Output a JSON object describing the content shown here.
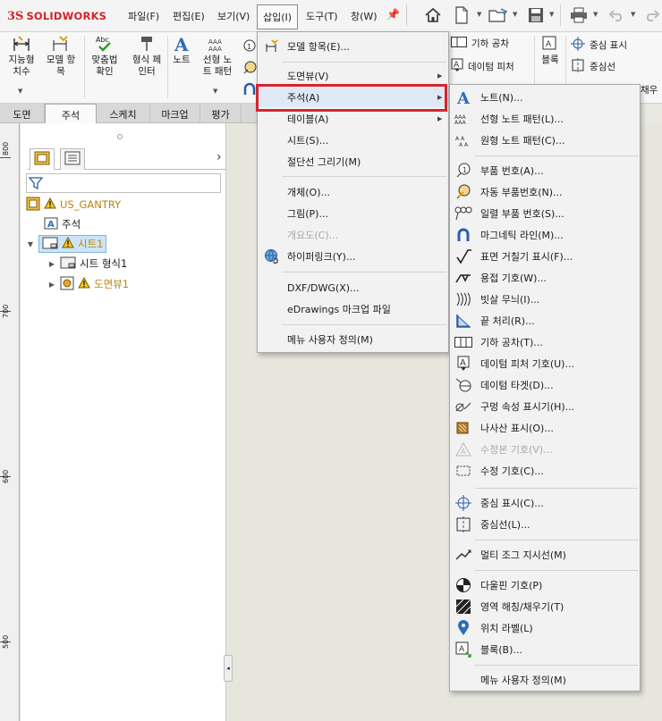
{
  "app": {
    "brand_prefix": "3S",
    "brand_name": "SOLIDWORKS"
  },
  "menubar": {
    "items": [
      "파일(F)",
      "편집(E)",
      "보기(V)",
      "삽입(I)",
      "도구(T)",
      "창(W)"
    ]
  },
  "toolbar": {
    "icons": [
      "home-icon",
      "new-document-icon",
      "open-icon",
      "save-icon",
      "print-icon",
      "undo-icon",
      "redo-icon"
    ]
  },
  "ribbon": {
    "buttons": [
      {
        "label": "지능형\n치수"
      },
      {
        "label": "모델 항\n목"
      },
      {
        "label": "맞춤법\n확인"
      },
      {
        "label": "형식 페\n인터"
      },
      {
        "label": "노트"
      },
      {
        "label": "선형 노\n트 패턴"
      }
    ],
    "small_items": [
      "기하 공차",
      "데이텀 피처",
      "블록",
      "중심 표시",
      "중심선",
      "채우"
    ]
  },
  "tabs": [
    "도면",
    "주석",
    "스케치",
    "마크업",
    "평가"
  ],
  "selected_tab": "주석",
  "ruler": {
    "labels": [
      "800",
      "700",
      "600",
      "500"
    ]
  },
  "tree": {
    "root": "US_GANTRY",
    "annotations": "주석",
    "sheet": "시트1",
    "sheet_format": "시트 형식1",
    "view": "도면뷰1"
  },
  "insert_menu": {
    "items": [
      {
        "label": "모델 항목(E)..."
      },
      {
        "label": "도면뷰(V)"
      },
      {
        "label": "주석(A)"
      },
      {
        "label": "테이블(A)"
      },
      {
        "label": "시트(S)..."
      },
      {
        "label": "절단선 그리기(M)"
      },
      {
        "label": "개체(O)..."
      },
      {
        "label": "그림(P)..."
      },
      {
        "label": "개요도(C)..."
      },
      {
        "label": "하이퍼링크(Y)..."
      },
      {
        "label": "DXF/DWG(X)..."
      },
      {
        "label": "eDrawings 마크업 파일"
      },
      {
        "label": "메뉴 사용자 정의(M)"
      }
    ]
  },
  "annotation_menu": {
    "items": [
      {
        "label": "노트(N)..."
      },
      {
        "label": "선형 노트 패턴(L)..."
      },
      {
        "label": "원형 노트 패턴(C)..."
      },
      {
        "label": "부품 번호(A)..."
      },
      {
        "label": "자동 부품번호(N)..."
      },
      {
        "label": "일렬 부품 번호(S)..."
      },
      {
        "label": "마그네틱 라인(M)..."
      },
      {
        "label": "표면 거칠기 표시(F)..."
      },
      {
        "label": "용접 기호(W)..."
      },
      {
        "label": "빗살 무늬(I)..."
      },
      {
        "label": "끝 처리(R)..."
      },
      {
        "label": "기하 공차(T)..."
      },
      {
        "label": "데이텀 피처 기호(U)..."
      },
      {
        "label": "데이텀 타겟(D)..."
      },
      {
        "label": "구멍 속성 표시기(H)..."
      },
      {
        "label": "나사산 표시(O)..."
      },
      {
        "label": "수정본 기호(V)..."
      },
      {
        "label": "수정 기호(C)..."
      },
      {
        "label": "중심 표시(C)..."
      },
      {
        "label": "중심선(L)..."
      },
      {
        "label": "멀티 조그 지시선(M)"
      },
      {
        "label": "다울핀 기호(P)"
      },
      {
        "label": "영역 해칭/채우기(T)"
      },
      {
        "label": "위치 라벨(L)"
      },
      {
        "label": "블록(B)..."
      },
      {
        "label": "메뉴 사용자 정의(M)"
      }
    ]
  }
}
